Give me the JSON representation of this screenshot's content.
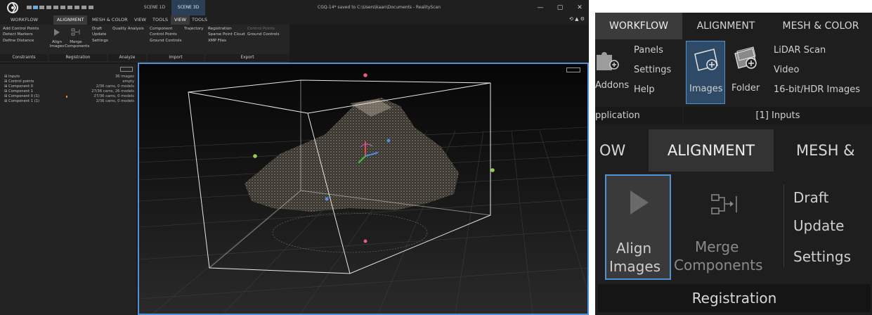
{
  "window": {
    "title": "CGQ-14* saved to C:\\Users\\kaan\\Documents - RealityScan",
    "minimize": "—",
    "maximize": "▢",
    "close": "✕"
  },
  "scene_tabs": [
    "SCENE 1D",
    "SCENE 3D"
  ],
  "ribbon_tabs": [
    "WORKFLOW",
    "ALIGNMENT",
    "MESH & COLOR",
    "VIEW",
    "TOOLS",
    "VIEW",
    "TOOLS"
  ],
  "ribbon": {
    "constraints": [
      "Add Control Points",
      "Detect Markers",
      "Define Distance"
    ],
    "align_label": [
      "Align",
      "Images"
    ],
    "merge_label": [
      "Merge",
      "Components"
    ],
    "registration_items": [
      "Draft",
      "Update",
      "Settings"
    ],
    "analyze_items": [
      "Quality Analysis"
    ],
    "import_col1": [
      "Component",
      "Control Points",
      "Ground Controls"
    ],
    "import_col2": [
      "Trajectory"
    ],
    "export_col1": [
      "Registration",
      "Sparse Point Cloud",
      "XMP Files"
    ],
    "export_col2": [
      "Control Points",
      "Ground Controls"
    ],
    "groups": [
      "Constraints",
      "Registration",
      "Analyze",
      "Import",
      "Export"
    ]
  },
  "tree": [
    {
      "label": "⊞ Inputs",
      "value": "36 images"
    },
    {
      "label": "⊞ Control points",
      "value": "empty"
    },
    {
      "label": "⊞ Component 0",
      "value": "2/36 cams, 0 models"
    },
    {
      "label": "⊞ Component 1",
      "value": "27/36 cams, 26 models"
    },
    {
      "label": "⊞ Component 0 (1)",
      "value": "27/36 cams, 0 models"
    },
    {
      "label": "⊞ Component 1 (1)",
      "value": "2/36 cams, 0 models"
    }
  ],
  "zoom1": {
    "tabs": [
      "WORKFLOW",
      "ALIGNMENT",
      "MESH & COLOR"
    ],
    "app_items": [
      "Panels",
      "Settings",
      "Help"
    ],
    "addons": "Addons",
    "images": "Images",
    "folder": "Folder",
    "input_items": [
      "LiDAR Scan",
      "Video",
      "16-bit/HDR Images"
    ],
    "group_application": "pplication",
    "group_inputs": "[1] Inputs"
  },
  "zoom2": {
    "tabs": [
      "OW",
      "ALIGNMENT",
      "MESH &"
    ],
    "align": [
      "Align",
      "Images"
    ],
    "merge": [
      "Merge",
      "Components"
    ],
    "registration_items": [
      "Draft",
      "Update",
      "Settings"
    ],
    "group": "Registration"
  },
  "colors": {
    "accent": "#4f93d6",
    "orange_mark": "#e08a2a",
    "background": "#1a1a1a"
  },
  "icons": {
    "logo": "realityscan-logo-icon",
    "align": "play-triangle-icon",
    "merge": "merge-components-icon",
    "addons": "puzzle-plus-icon",
    "images": "image-plus-icon",
    "folder": "folder-plus-icon",
    "gizmo": "xyz-gizmo-icon"
  }
}
